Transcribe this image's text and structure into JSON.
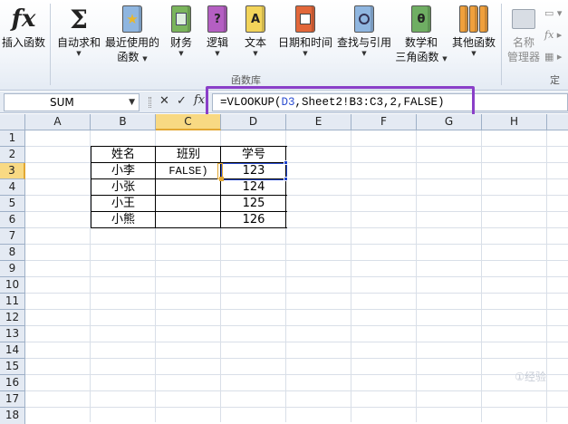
{
  "ribbon": {
    "buttons": [
      {
        "label": "插入函数",
        "icon": "fx-icon",
        "has_arrow": false
      },
      {
        "label": "自动求和",
        "icon": "sigma-icon",
        "has_arrow": true
      },
      {
        "label": "最近使用的",
        "label2": "函数",
        "icon": "star-book-icon",
        "has_arrow": true
      },
      {
        "label": "财务",
        "icon": "finance-book-icon",
        "has_arrow": true
      },
      {
        "label": "逻辑",
        "icon": "logic-book-icon",
        "has_arrow": true
      },
      {
        "label": "文本",
        "icon": "text-book-icon",
        "has_arrow": true
      },
      {
        "label": "日期和时间",
        "icon": "date-book-icon",
        "has_arrow": true
      },
      {
        "label": "查找与引用",
        "icon": "lookup-book-icon",
        "has_arrow": true
      },
      {
        "label": "数学和",
        "label2": "三角函数",
        "icon": "math-book-icon",
        "has_arrow": true
      },
      {
        "label": "其他函数",
        "icon": "other-books-icon",
        "has_arrow": true
      },
      {
        "label": "名称",
        "label2": "管理器",
        "icon": "name-manager-icon",
        "has_arrow": false
      }
    ],
    "group_label": "函数库",
    "group_label_right": "定",
    "icon_glyphs": {
      "logic": "?",
      "text": "A",
      "math": "θ"
    },
    "colors": {
      "finance": "#7ab55c",
      "logic": "#b45fc2",
      "text": "#f2d45a",
      "date": "#e2673a",
      "lookup": "#8fb6e0",
      "math": "#6fae63",
      "other": "#f0a03c"
    }
  },
  "formula_bar": {
    "name_box": "SUM",
    "cancel": "✕",
    "enter": "✓",
    "fx": "fx",
    "formula_prefix": "=VLOOKUP(",
    "formula_ref": "D3",
    "formula_suffix": ",Sheet2!B3:C3,2,FALSE)"
  },
  "grid": {
    "columns": [
      "A",
      "B",
      "C",
      "D",
      "E",
      "F",
      "G",
      "H"
    ],
    "rows": [
      "1",
      "2",
      "3",
      "4",
      "5",
      "6",
      "7",
      "8",
      "9",
      "10",
      "11",
      "12",
      "13",
      "14",
      "15",
      "16",
      "17",
      "18"
    ],
    "selected_column": "C",
    "selected_row": "3",
    "table": {
      "headers": [
        "姓名",
        "班别",
        "学号"
      ],
      "rows": [
        [
          "小李",
          "FALSE)",
          "123"
        ],
        [
          "小张",
          "",
          "124"
        ],
        [
          "小王",
          "",
          "125"
        ],
        [
          "小熊",
          "",
          "126"
        ]
      ]
    }
  },
  "watermark": "①经验"
}
